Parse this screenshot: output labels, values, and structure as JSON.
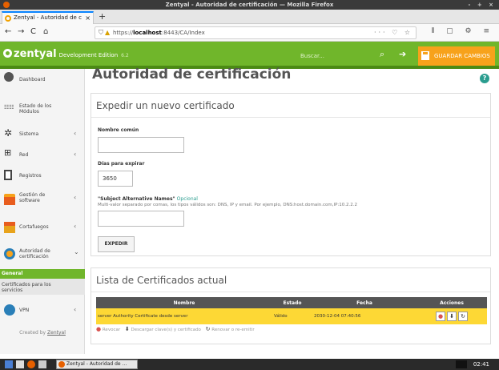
{
  "window": {
    "title": "Zentyal - Autoridad de certificación — Mozilla Firefox",
    "controls": "- + ×"
  },
  "browser": {
    "tab_title": "Zentyal - Autoridad de c",
    "tab_close": "×",
    "new_tab": "+",
    "back": "←",
    "forward": "→",
    "reload": "C",
    "home": "⌂",
    "url_prefix": "https://",
    "url_host": "localhost",
    "url_rest": ":8443/CA/Index",
    "url_icons": "··· ♡ ☆",
    "nav_right_icons": "⫴ ▢ ⚙ ≡"
  },
  "header": {
    "logo": "zentyal",
    "edition": "Development Edition",
    "version": "6.2",
    "search_placeholder": "Buscar...",
    "save_label": "GUARDAR CAMBIOS"
  },
  "sidebar": {
    "items": [
      {
        "label1": "Dashboard",
        "label2": "",
        "chevron": ""
      },
      {
        "label1": "Estado de los",
        "label2": "Módulos",
        "chevron": ""
      },
      {
        "label1": "Sistema",
        "label2": "",
        "chevron": "‹"
      },
      {
        "label1": "Red",
        "label2": "",
        "chevron": "‹"
      },
      {
        "label1": "Registros",
        "label2": "",
        "chevron": ""
      },
      {
        "label1": "Gestión de",
        "label2": "software",
        "chevron": "‹"
      },
      {
        "label1": "Cortafuegos",
        "label2": "",
        "chevron": "‹"
      },
      {
        "label1": "Autoridad de",
        "label2": "certificación",
        "chevron": "⌄"
      }
    ],
    "general_header": "General",
    "general_item_line1": "Certificados para los",
    "general_item_line2": "servicios",
    "vpn": {
      "label1": "VPN",
      "chevron": "‹"
    },
    "created_by": "Created by",
    "created_by_link": "Zentyal"
  },
  "main": {
    "title": "Autoridad de certificación",
    "help": "?",
    "issue_panel": {
      "title": "Expedir un nuevo certificado",
      "common_name_label": "Nombre común",
      "common_name_value": "",
      "days_label": "Días para expirar",
      "days_value": "3650",
      "san_label": "\"Subject Alternative Names\"",
      "san_optional": "Opcional",
      "san_help": "Multi-valor separado por comas, los tipos válidos son: DNS, IP y email. Por ejemplo, DNS:host.domain.com,IP:10.2.2.2",
      "san_value": "",
      "submit": "EXPEDIR"
    },
    "list_panel": {
      "title": "Lista de Certificados actual",
      "columns": [
        "Nombre",
        "Estado",
        "Fecha",
        "Acciones"
      ],
      "rows": [
        {
          "name": "server Authority Certificate desde server",
          "state": "Válido",
          "date": "2030-12-04 07:40:56"
        }
      ],
      "legend": {
        "revoke": "Revocar",
        "download": "Descargar clave(s) y certificado",
        "renew": "Renovar o re-emitir"
      }
    }
  },
  "taskbar": {
    "window_label": "Zentyal - Autoridad de ...",
    "clock": "02:41"
  }
}
